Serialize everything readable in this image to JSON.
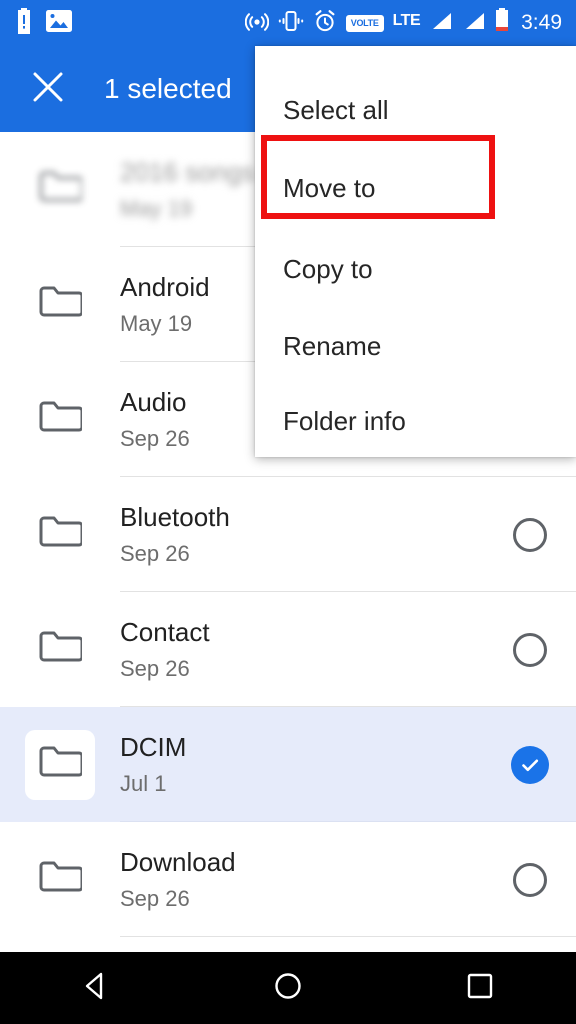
{
  "status_bar": {
    "left_icons": [
      {
        "name": "battery-alert-icon",
        "label": "battery alert"
      },
      {
        "name": "image-icon",
        "label": "screenshot saved"
      }
    ],
    "right_icons": [
      {
        "name": "hotspot-icon",
        "label": "hotspot"
      },
      {
        "name": "vibrate-icon",
        "label": "vibrate"
      },
      {
        "name": "alarm-icon",
        "label": "alarm"
      }
    ],
    "volte_label": "VOLTE",
    "network_label": "LTE",
    "signal_bars": 2,
    "battery_low": true,
    "time": "3:49",
    "background_color": "#1b6ee0"
  },
  "app_bar": {
    "close_icon": "close-icon",
    "title": "1 selected",
    "background_color": "#1b6ee0"
  },
  "menu": {
    "items": [
      {
        "label": "Select all",
        "name": "menu-item-select-all",
        "highlighted": false
      },
      {
        "label": "Move to",
        "name": "menu-item-move-to",
        "highlighted": true
      },
      {
        "label": "Copy to",
        "name": "menu-item-copy-to",
        "highlighted": false
      },
      {
        "label": "Rename",
        "name": "menu-item-rename",
        "highlighted": false
      },
      {
        "label": "Folder info",
        "name": "menu-item-folder-info",
        "highlighted": false
      }
    ],
    "highlight_color": "#ee1111"
  },
  "file_list": {
    "rows": [
      {
        "name": "2016 songs",
        "date": "May 19",
        "selected": false,
        "blurred": true,
        "checkbox_visible": false
      },
      {
        "name": "Android",
        "date": "May 19",
        "selected": false,
        "blurred": false,
        "checkbox_visible": false
      },
      {
        "name": "Audio",
        "date": "Sep 26",
        "selected": false,
        "blurred": false,
        "checkbox_visible": false
      },
      {
        "name": "Bluetooth",
        "date": "Sep 26",
        "selected": false,
        "blurred": false,
        "checkbox_visible": true
      },
      {
        "name": "Contact",
        "date": "Sep 26",
        "selected": false,
        "blurred": false,
        "checkbox_visible": true
      },
      {
        "name": "DCIM",
        "date": "Jul 1",
        "selected": true,
        "blurred": false,
        "checkbox_visible": true
      },
      {
        "name": "Download",
        "date": "Sep 26",
        "selected": false,
        "blurred": false,
        "checkbox_visible": true
      }
    ],
    "selected_row_color": "#e6ebfa",
    "check_color": "#1a73e8",
    "folder_icon": "folder-icon"
  },
  "nav_bar": {
    "back_label": "Back",
    "home_label": "Home",
    "recents_label": "Recents",
    "background_color": "#000000"
  }
}
